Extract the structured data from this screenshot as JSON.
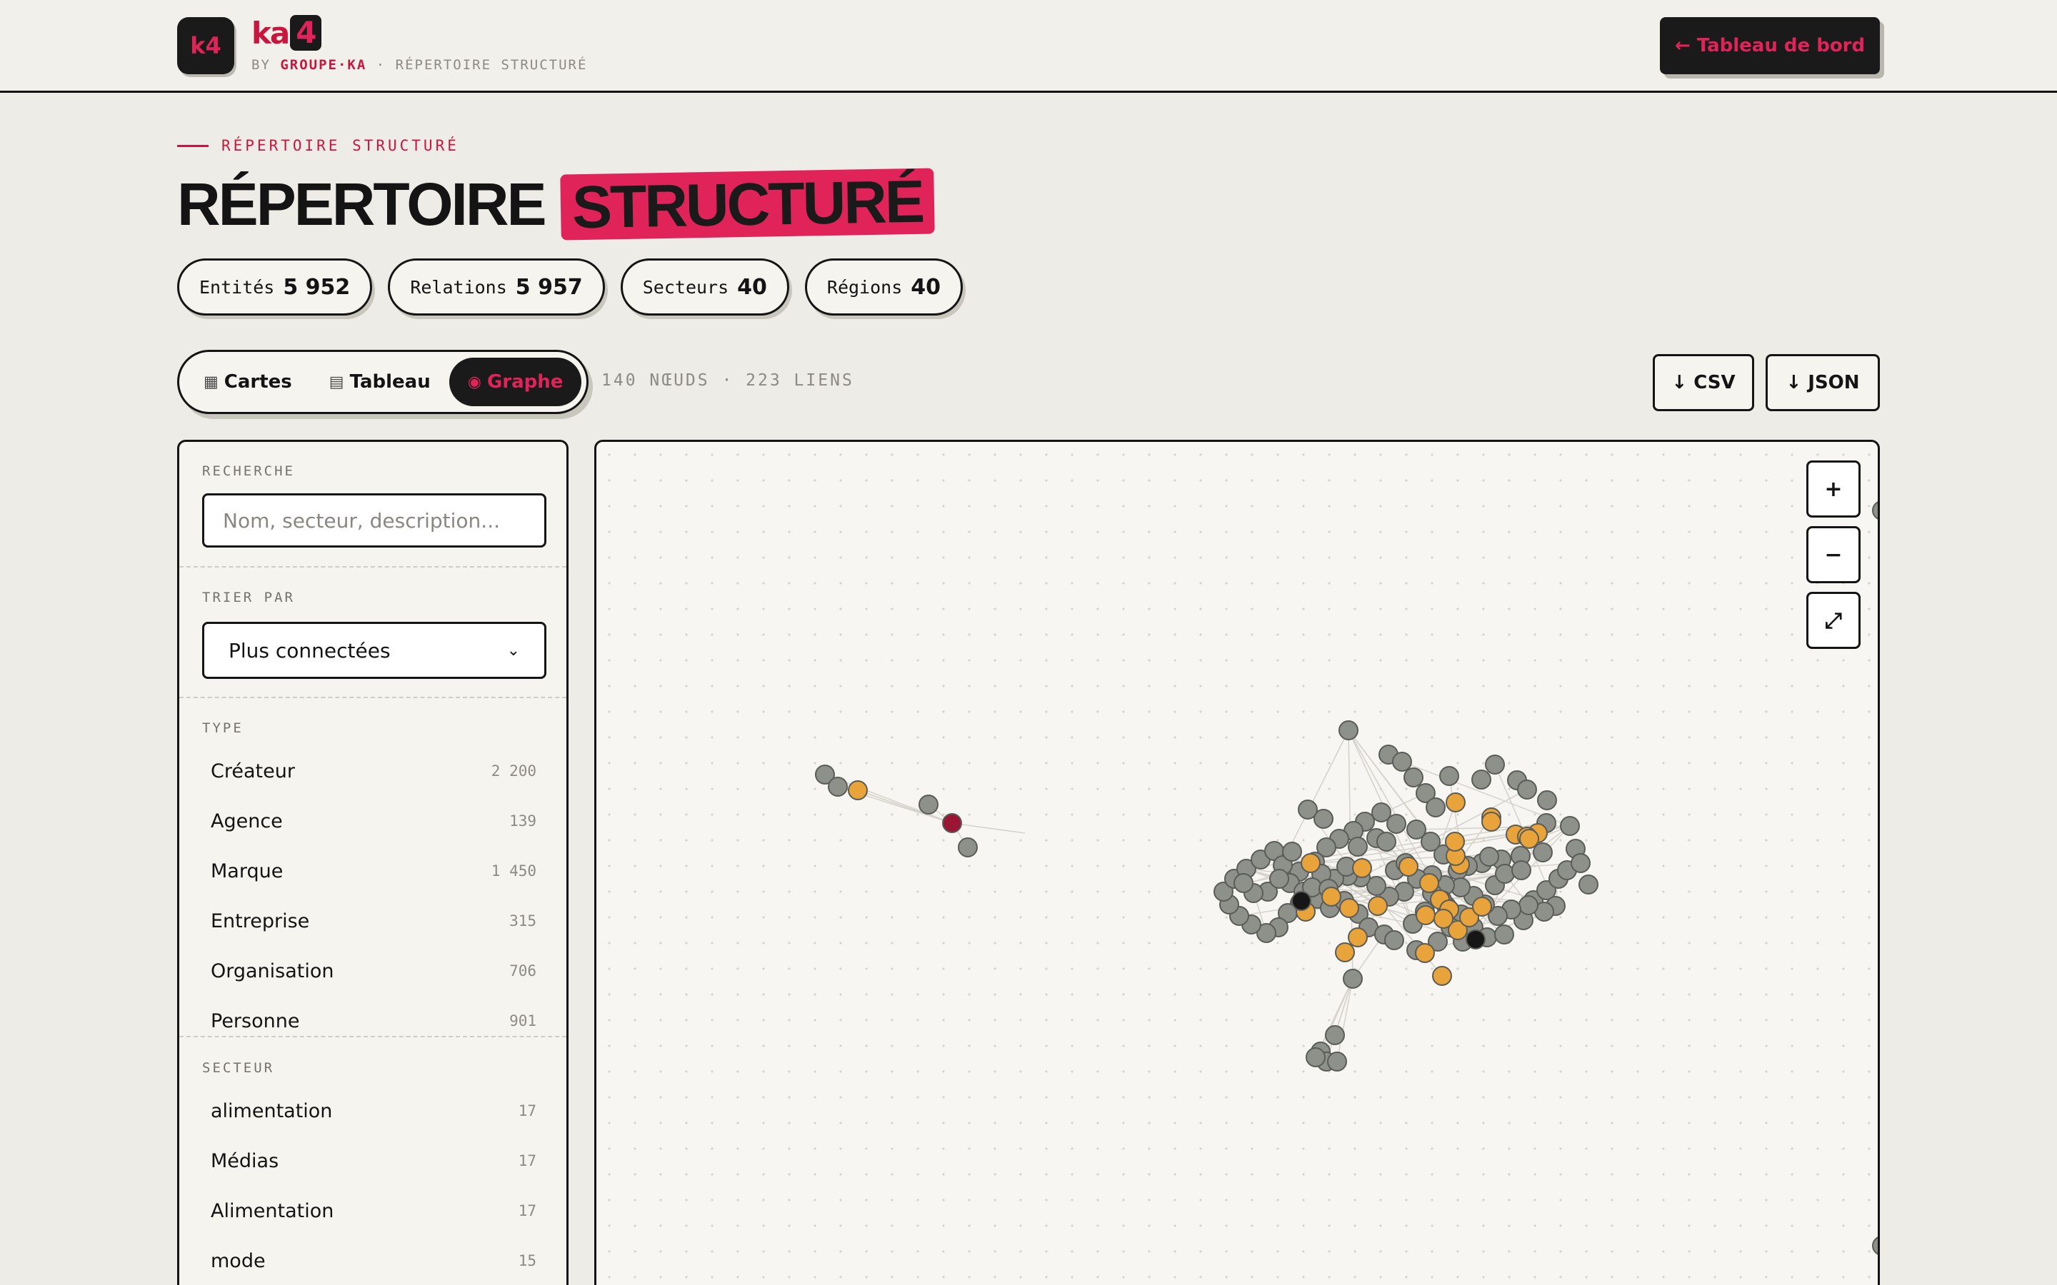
{
  "header": {
    "logo_text": "k4",
    "brand_text": "ka",
    "brand_num": "4",
    "by_label": "BY",
    "company": "GROUPE·KA",
    "sep": "·",
    "section": "RÉPERTOIRE STRUCTURÉ",
    "back_label": "← Tableau de bord"
  },
  "page": {
    "eyebrow": "RÉPERTOIRE STRUCTURÉ",
    "title_main": "RÉPERTOIRE",
    "title_highlight": "STRUCTURÉ"
  },
  "stats": [
    {
      "label": "Entités",
      "value": "5 952"
    },
    {
      "label": "Relations",
      "value": "5 957"
    },
    {
      "label": "Secteurs",
      "value": "40"
    },
    {
      "label": "Régions",
      "value": "40"
    }
  ],
  "views": {
    "cards_label": "Cartes",
    "table_label": "Tableau",
    "graph_label": "Graphe",
    "active": "Graphe",
    "counts_text": "140 NŒUDS · 223 LIENS"
  },
  "export": {
    "csv_label": "↓ CSV",
    "json_label": "↓ JSON"
  },
  "sidebar": {
    "search_label": "RECHERCHE",
    "search_placeholder": "Nom, secteur, description...",
    "search_value": "",
    "sort_label": "TRIER PAR",
    "sort_value": "Plus connectées",
    "type_label": "TYPE",
    "types": [
      {
        "name": "Créateur",
        "count": "2 200"
      },
      {
        "name": "Agence",
        "count": "139"
      },
      {
        "name": "Marque",
        "count": "1 450"
      },
      {
        "name": "Entreprise",
        "count": "315"
      },
      {
        "name": "Organisation",
        "count": "706"
      },
      {
        "name": "Personne",
        "count": "901"
      }
    ],
    "sector_label": "SECTEUR",
    "sectors": [
      {
        "name": "alimentation",
        "count": "17"
      },
      {
        "name": "Médias",
        "count": "17"
      },
      {
        "name": "Alimentation",
        "count": "17"
      },
      {
        "name": "mode",
        "count": "15"
      }
    ]
  },
  "graph_controls": {
    "zoom_in": "+",
    "zoom_out": "−",
    "fit": "⤢"
  },
  "colors": {
    "accent": "#e0245a",
    "dark": "#1a1a1a",
    "node_default": "#8e918a",
    "node_highlight": "#e8a33a",
    "node_selected": "#9b1536",
    "node_dark": "#161616"
  }
}
